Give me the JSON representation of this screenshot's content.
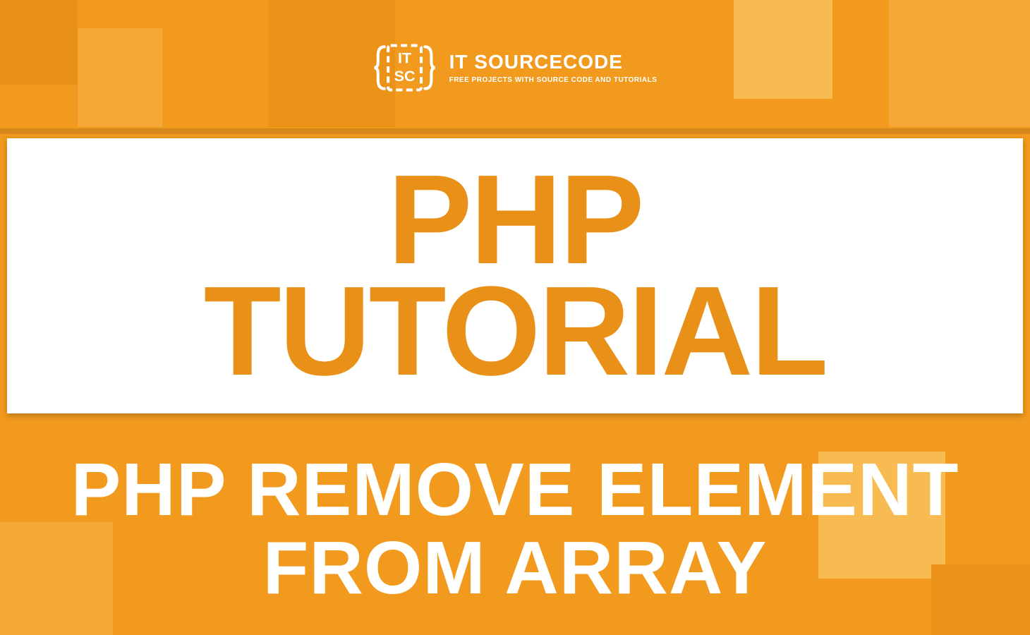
{
  "brand": {
    "name": "IT SOURCECODE",
    "tagline": "FREE PROJECTS WITH SOURCE CODE AND TUTORIALS"
  },
  "main": {
    "title_line1": "PHP",
    "title_line2": "TUTORIAL"
  },
  "subtitle": {
    "line1": "PHP REMOVE ELEMENT",
    "line2": "FROM ARRAY"
  },
  "colors": {
    "primary": "#f29a1e",
    "accent_orange": "#e89018",
    "light_orange": "#f4a838",
    "pale_orange": "#f7bb52",
    "white": "#ffffff"
  }
}
